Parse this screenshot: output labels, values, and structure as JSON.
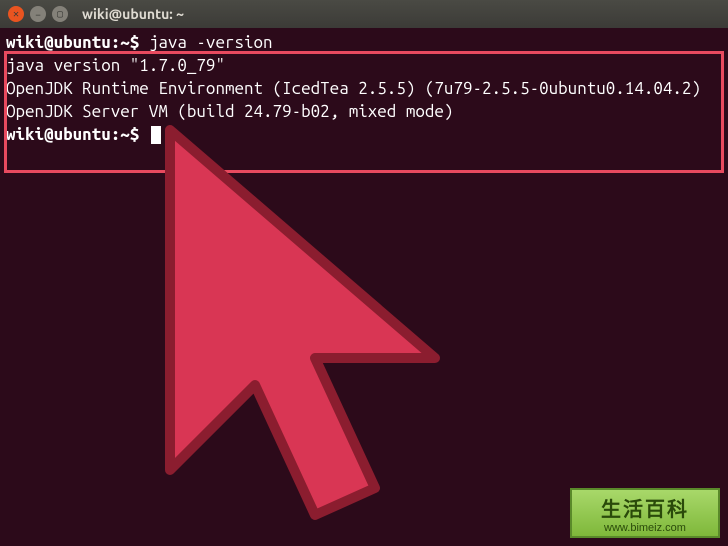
{
  "window": {
    "title": "wiki@ubuntu: ~"
  },
  "terminal": {
    "prompt": "wiki@ubuntu:~$",
    "command": "java -version",
    "output_line1": "java version \"1.7.0_79\"",
    "output_line2": "OpenJDK Runtime Environment (IcedTea 2.5.5) (7u79-2.5.5-0ubuntu0.14.04.2)",
    "output_line3": "OpenJDK Server VM (build 24.79-b02, mixed mode)"
  },
  "watermark": {
    "main": "生活百科",
    "url": "www.bimeiz.com"
  },
  "colors": {
    "highlight_border": "#e84a5f",
    "cursor_fill": "#d93654",
    "cursor_stroke": "#8b1d2f",
    "terminal_bg": "#2c0a1a"
  }
}
